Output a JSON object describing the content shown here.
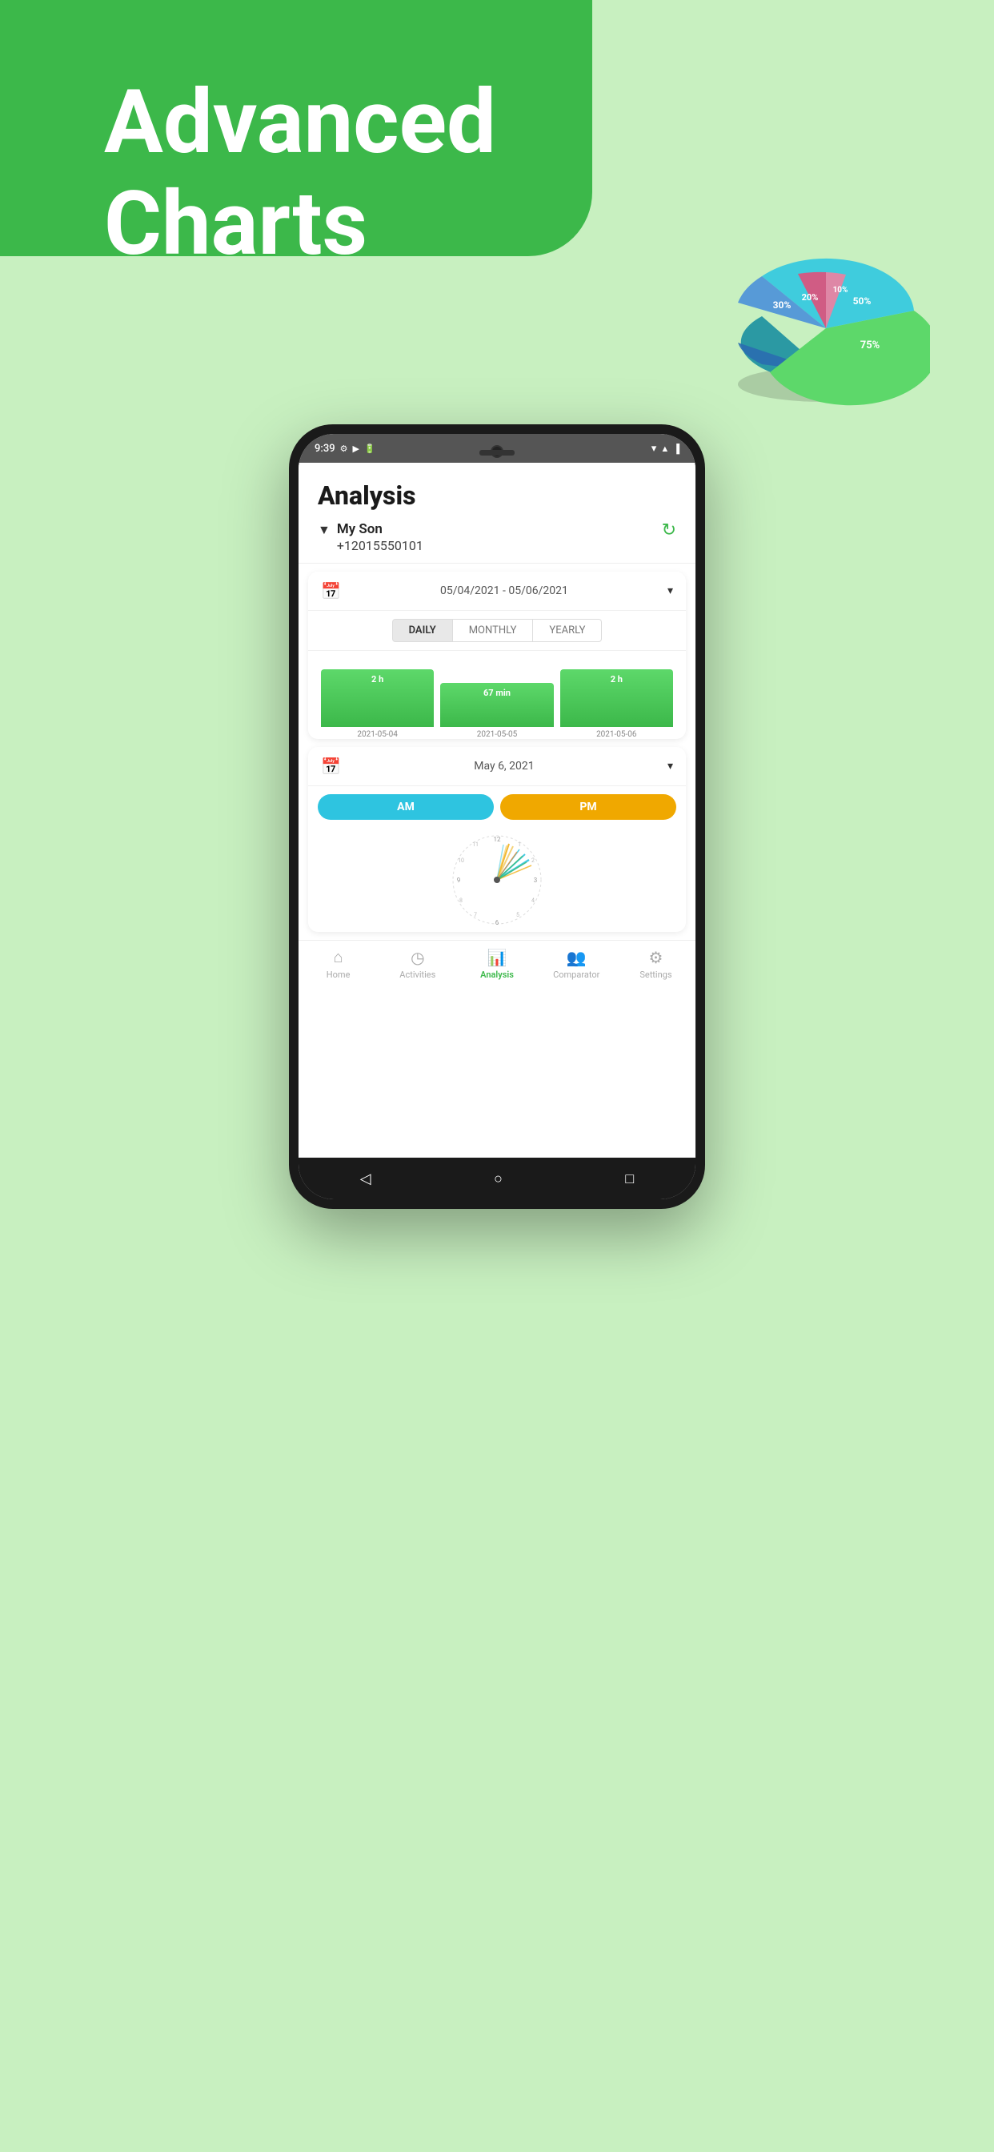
{
  "hero": {
    "title_line1": "Advanced",
    "title_line2": "Charts",
    "bg_color": "#3cb84a"
  },
  "pie_chart": {
    "segments": [
      {
        "label": "75%",
        "color": "#5dd86a",
        "value": 75
      },
      {
        "label": "50%",
        "color": "#2db3c8",
        "value": 50
      },
      {
        "label": "30%",
        "color": "#4a90d9",
        "value": 30
      },
      {
        "label": "20%",
        "color": "#e05080",
        "value": 20
      },
      {
        "label": "10%",
        "color": "#f06090",
        "value": 10
      }
    ]
  },
  "phone": {
    "status_time": "9:39",
    "screen": {
      "title": "Analysis",
      "user": {
        "name": "My Son",
        "phone": "+12015550101"
      },
      "date_range": "05/04/2021 - 05/06/2021",
      "period_tabs": [
        "DAILY",
        "MONTHLY",
        "YEARLY"
      ],
      "active_tab": "DAILY",
      "bars": [
        {
          "label": "2 h",
          "date": "2021-05-04",
          "height": 72
        },
        {
          "label": "67 min",
          "date": "2021-05-05",
          "height": 55
        },
        {
          "label": "2 h",
          "date": "2021-05-06",
          "height": 72
        }
      ],
      "single_date": "May 6, 2021",
      "am_label": "AM",
      "pm_label": "PM",
      "nav_items": [
        {
          "id": "home",
          "label": "Home",
          "icon": "⌂",
          "active": false
        },
        {
          "id": "activities",
          "label": "Activities",
          "icon": "◷",
          "active": false
        },
        {
          "id": "analysis",
          "label": "Analysis",
          "icon": "📊",
          "active": true
        },
        {
          "id": "comparator",
          "label": "Comparator",
          "icon": "👥",
          "active": false
        },
        {
          "id": "settings",
          "label": "Settings",
          "icon": "⚙",
          "active": false
        }
      ]
    }
  }
}
